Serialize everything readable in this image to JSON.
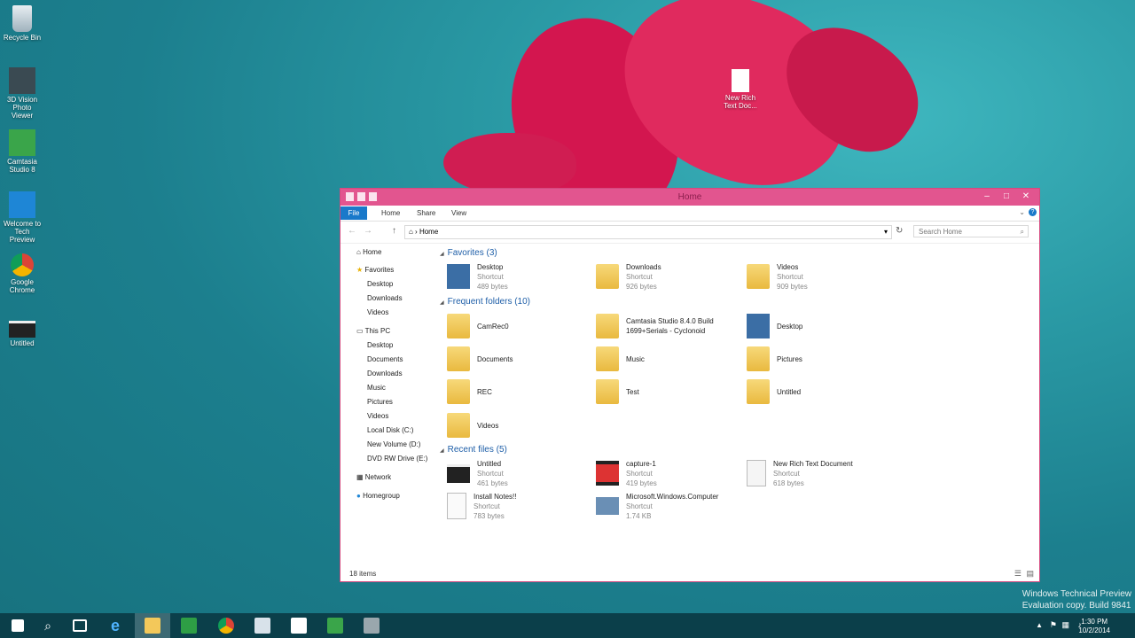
{
  "desktop": {
    "icons": [
      {
        "label": "Recycle Bin"
      },
      {
        "label": "3D Vision Photo Viewer"
      },
      {
        "label": "Camtasia Studio 8"
      },
      {
        "label": "Welcome to Tech Preview"
      },
      {
        "label": "Google Chrome"
      },
      {
        "label": "Untitled"
      },
      {
        "label": "New Rich Text Doc..."
      }
    ],
    "watermark_line1": "Windows Technical Preview",
    "watermark_line2": "Evaluation copy. Build 9841"
  },
  "window": {
    "title": "Home",
    "ribbon": {
      "file": "File",
      "home": "Home",
      "share": "Share",
      "view": "View"
    },
    "address": "Home",
    "search_placeholder": "Search Home",
    "status": "18 items"
  },
  "nav": {
    "home": "Home",
    "favorites": "Favorites",
    "fav_items": [
      "Desktop",
      "Downloads",
      "Videos"
    ],
    "this_pc": "This PC",
    "pc_items": [
      "Desktop",
      "Documents",
      "Downloads",
      "Music",
      "Pictures",
      "Videos",
      "Local Disk (C:)",
      "New Volume (D:)",
      "DVD RW Drive (E:)"
    ],
    "network": "Network",
    "homegroup": "Homegroup"
  },
  "groups": {
    "favorites": "Favorites (3)",
    "frequent": "Frequent folders (10)",
    "recent": "Recent files (5)"
  },
  "favorites": [
    {
      "name": "Desktop",
      "type": "Shortcut",
      "size": "489 bytes"
    },
    {
      "name": "Downloads",
      "type": "Shortcut",
      "size": "926 bytes"
    },
    {
      "name": "Videos",
      "type": "Shortcut",
      "size": "909 bytes"
    }
  ],
  "frequent": [
    {
      "name": "CamRec0"
    },
    {
      "name": "Camtasia Studio 8.4.0 Build 1699+Serials - Cyclonoid"
    },
    {
      "name": "Desktop"
    },
    {
      "name": "Documents"
    },
    {
      "name": "Music"
    },
    {
      "name": "Pictures"
    },
    {
      "name": "REC"
    },
    {
      "name": "Test"
    },
    {
      "name": "Untitled"
    },
    {
      "name": "Videos"
    }
  ],
  "recent": [
    {
      "name": "Untitled",
      "type": "Shortcut",
      "size": "461 bytes"
    },
    {
      "name": "capture-1",
      "type": "Shortcut",
      "size": "419 bytes"
    },
    {
      "name": "New Rich Text Document",
      "type": "Shortcut",
      "size": "618 bytes"
    },
    {
      "name": "Install Notes!!",
      "type": "Shortcut",
      "size": "783 bytes"
    },
    {
      "name": "Microsoft.Windows.Computer",
      "type": "Shortcut",
      "size": "1.74 KB"
    }
  ],
  "taskbar": {
    "time": "1:30 PM",
    "date": "10/2/2014"
  }
}
